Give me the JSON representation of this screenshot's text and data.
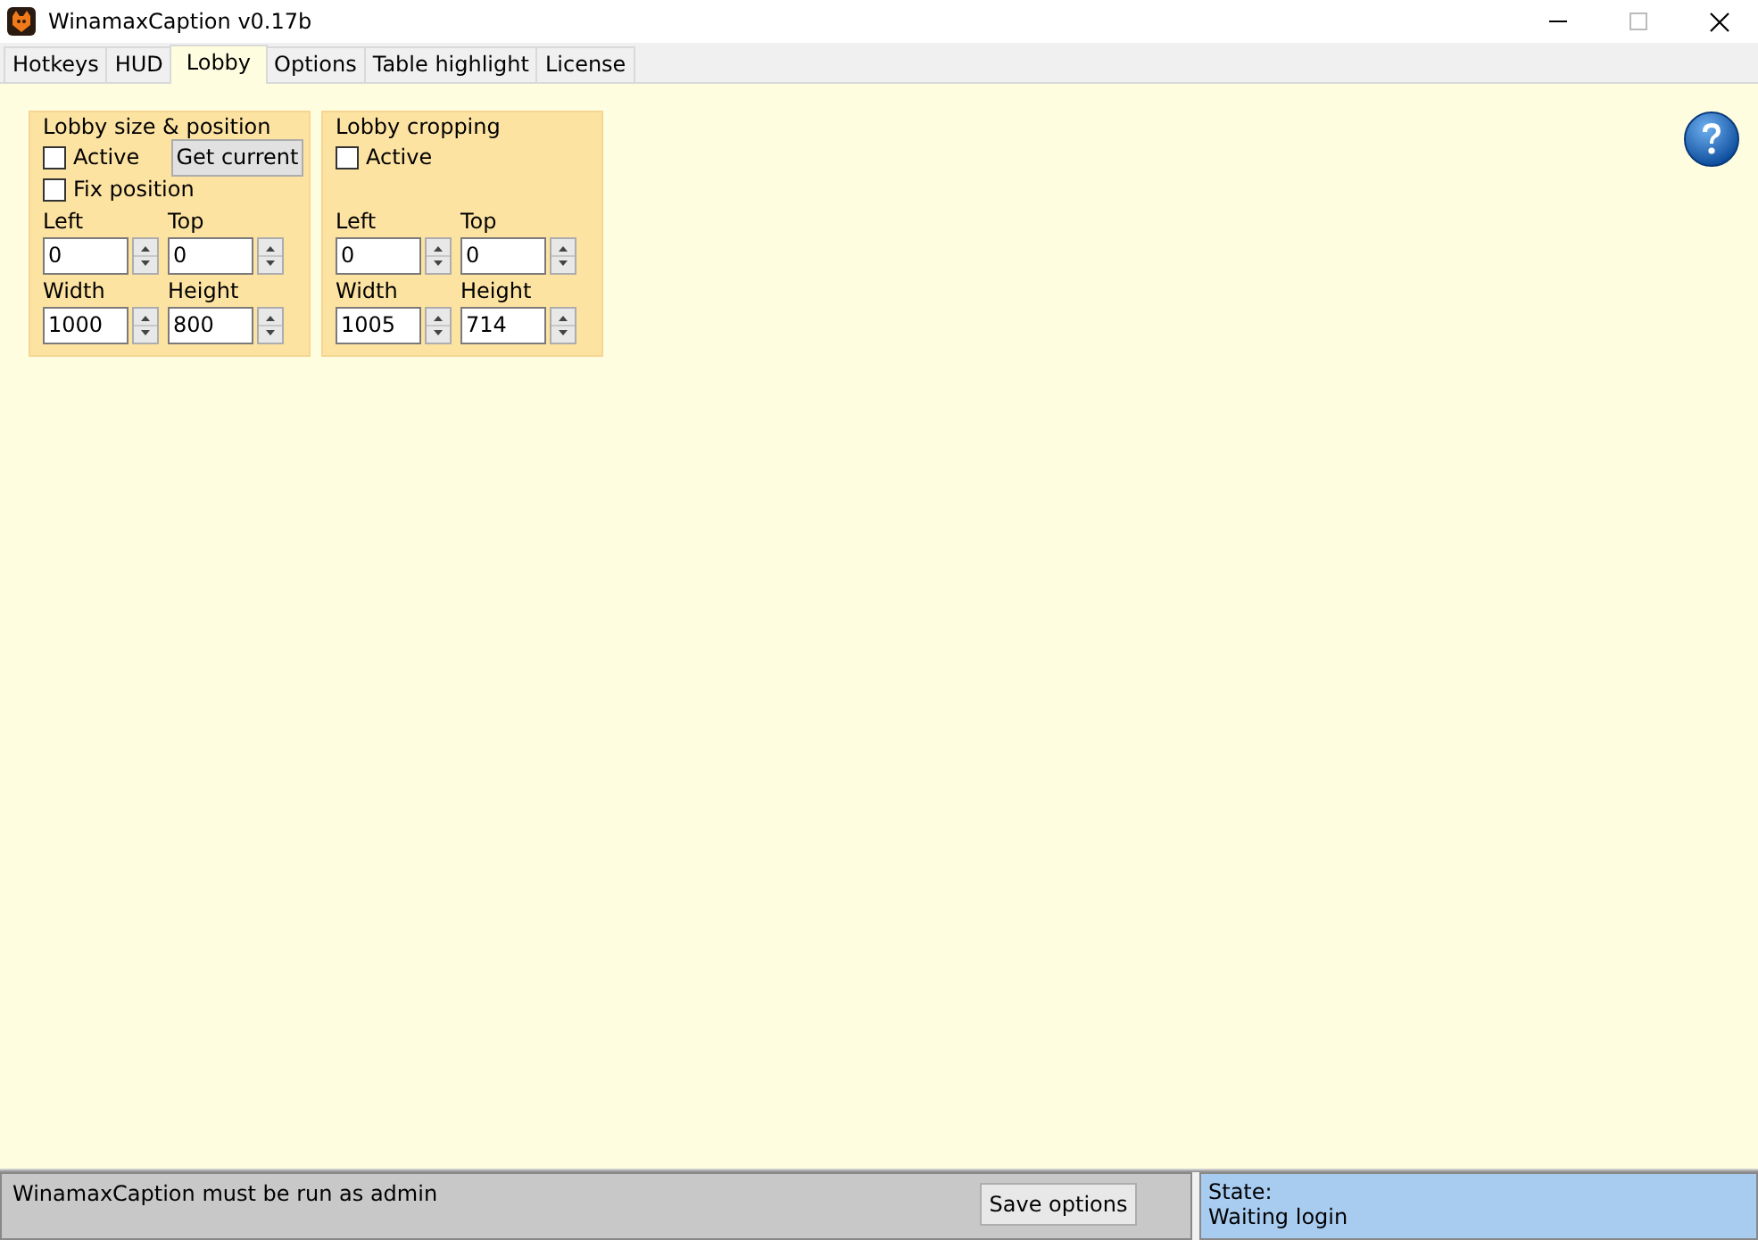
{
  "window": {
    "title": "WinamaxCaption v0.17b"
  },
  "tabs": [
    {
      "label": "Hotkeys",
      "selected": false
    },
    {
      "label": "HUD",
      "selected": false
    },
    {
      "label": "Lobby",
      "selected": true
    },
    {
      "label": "Options",
      "selected": false
    },
    {
      "label": "Table highlight",
      "selected": false
    },
    {
      "label": "License",
      "selected": false
    }
  ],
  "groups": [
    {
      "title": "Lobby size & position",
      "checkboxes": [
        {
          "label": "Active",
          "checked": false
        },
        {
          "label": "Fix position",
          "checked": false
        }
      ],
      "button": "Get current",
      "fields": [
        {
          "label": "Left",
          "value": "0"
        },
        {
          "label": "Top",
          "value": "0"
        },
        {
          "label": "Width",
          "value": "1000"
        },
        {
          "label": "Height",
          "value": "800"
        }
      ]
    },
    {
      "title": "Lobby cropping",
      "checkboxes": [
        {
          "label": "Active",
          "checked": false
        }
      ],
      "fields": [
        {
          "label": "Left",
          "value": "0"
        },
        {
          "label": "Top",
          "value": "0"
        },
        {
          "label": "Width",
          "value": "1005"
        },
        {
          "label": "Height",
          "value": "714"
        }
      ]
    }
  ],
  "status_bar": {
    "message": "WinamaxCaption must be run as admin",
    "save_button": "Save options",
    "state_label": "State:",
    "state_value": "Waiting login"
  }
}
